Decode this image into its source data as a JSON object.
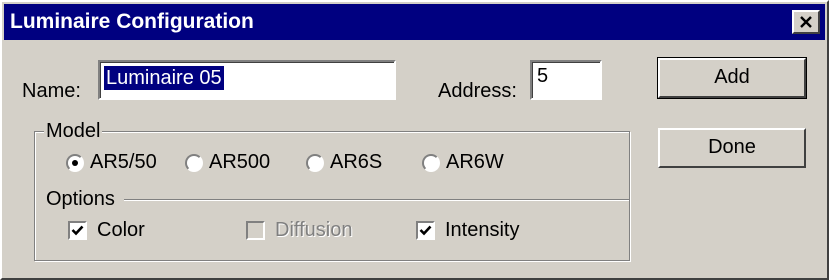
{
  "window": {
    "title": "Luminaire Configuration",
    "close_glyph": "✕",
    "titlebar_color": "#000080",
    "background_color": "#d4d0c8"
  },
  "fields": {
    "name_label": "Name:",
    "name_value": "Luminaire 05",
    "address_label": "Address:",
    "address_value": "5"
  },
  "buttons": {
    "add_label": "Add",
    "done_label": "Done"
  },
  "model": {
    "legend": "Model",
    "options": [
      {
        "label": "AR5/50",
        "checked": true
      },
      {
        "label": "AR500",
        "checked": false
      },
      {
        "label": "AR6S",
        "checked": false
      },
      {
        "label": "AR6W",
        "checked": false
      }
    ]
  },
  "options": {
    "legend": "Options",
    "items": [
      {
        "label": "Color",
        "checked": true,
        "enabled": true
      },
      {
        "label": "Diffusion",
        "checked": false,
        "enabled": false
      },
      {
        "label": "Intensity",
        "checked": true,
        "enabled": true
      }
    ]
  },
  "icons": {
    "close": "close-icon",
    "check": "checkmark-icon"
  }
}
